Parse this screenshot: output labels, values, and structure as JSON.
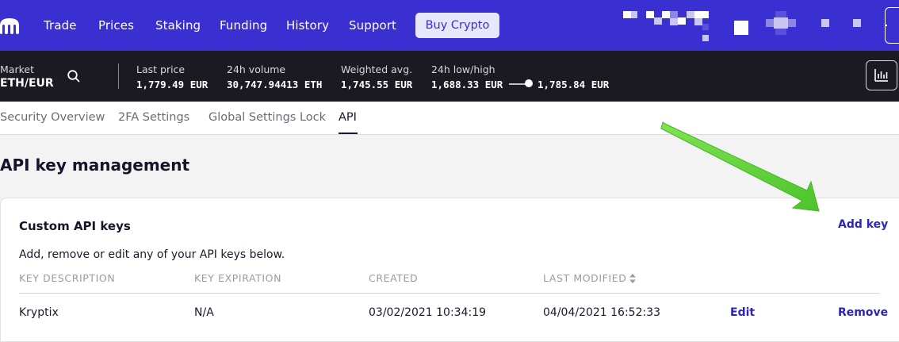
{
  "topnav": {
    "items": [
      "Trade",
      "Prices",
      "Staking",
      "Funding",
      "History",
      "Support"
    ],
    "buy_label": "Buy Crypto"
  },
  "market": {
    "pair_label": "Market",
    "pair": "ETH/EUR",
    "stats": [
      {
        "label": "Last price",
        "value": "1,779.49 EUR"
      },
      {
        "label": "24h volume",
        "value": "30,747.94413 ETH"
      },
      {
        "label": "Weighted avg.",
        "value": "1,745.55 EUR"
      },
      {
        "label": "24h low/high",
        "low": "1,688.33 EUR",
        "high": "1,785.84 EUR"
      }
    ]
  },
  "tabs": [
    {
      "label": "Security Overview",
      "active": false
    },
    {
      "label": "2FA Settings",
      "active": false
    },
    {
      "label": "Global Settings Lock",
      "active": false
    },
    {
      "label": "API",
      "active": true
    }
  ],
  "page_title": "API key management",
  "card": {
    "title": "Custom API keys",
    "add_label": "Add key",
    "description": "Add, remove or edit any of your API keys below.",
    "columns": [
      "KEY DESCRIPTION",
      "KEY EXPIRATION",
      "CREATED",
      "LAST MODIFIED"
    ],
    "rows": [
      {
        "description": "Kryptix",
        "expiration": "N/A",
        "created": "03/02/2021 10:34:19",
        "modified": "04/04/2021 16:52:33",
        "edit": "Edit",
        "remove": "Remove"
      }
    ]
  },
  "colors": {
    "brand": "#3a2fd0",
    "market_bar": "#1b1a22",
    "link": "#2d24b8",
    "annotation_arrow": "#5fd23a"
  },
  "icons": [
    "kraken-logo-icon",
    "search-icon",
    "chart-icon",
    "sort-icon",
    "arrow-annotation-icon"
  ]
}
